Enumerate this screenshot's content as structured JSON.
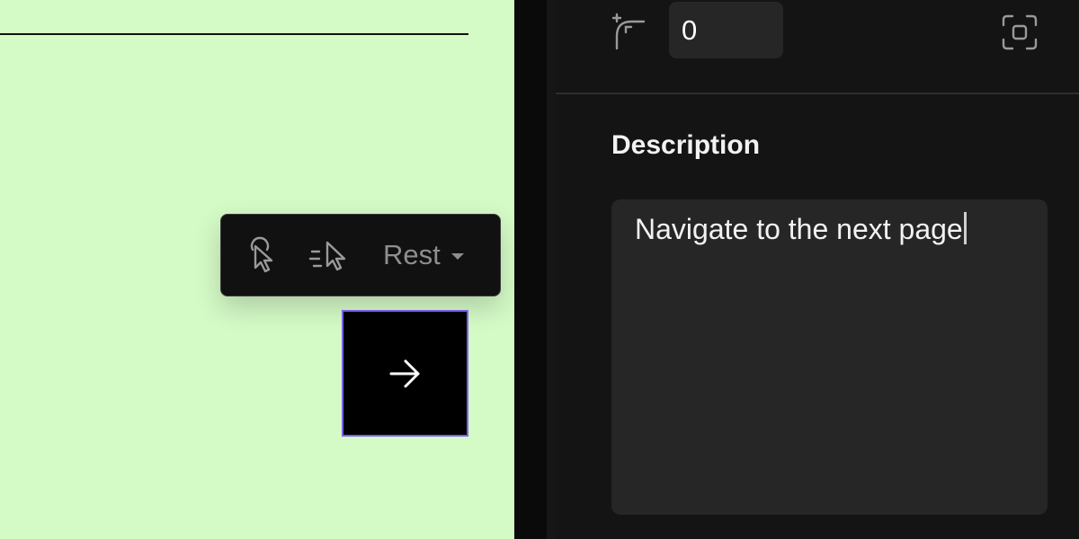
{
  "toolbar": {
    "tap_icon": "tap-pointer-icon",
    "drag_icon": "drag-pointer-icon",
    "state_label": "Rest",
    "state_caret_icon": "caret-down-icon"
  },
  "canvas": {
    "background": "#d4fac6",
    "next_button_icon": "arrow-right-icon",
    "selection_color": "#7b61e8"
  },
  "panel": {
    "radius_icon": "corner-radius-icon",
    "radius_value": "0",
    "focus_icon": "focus-frame-icon",
    "description_title": "Description",
    "description_value": "Navigate to the next page"
  }
}
